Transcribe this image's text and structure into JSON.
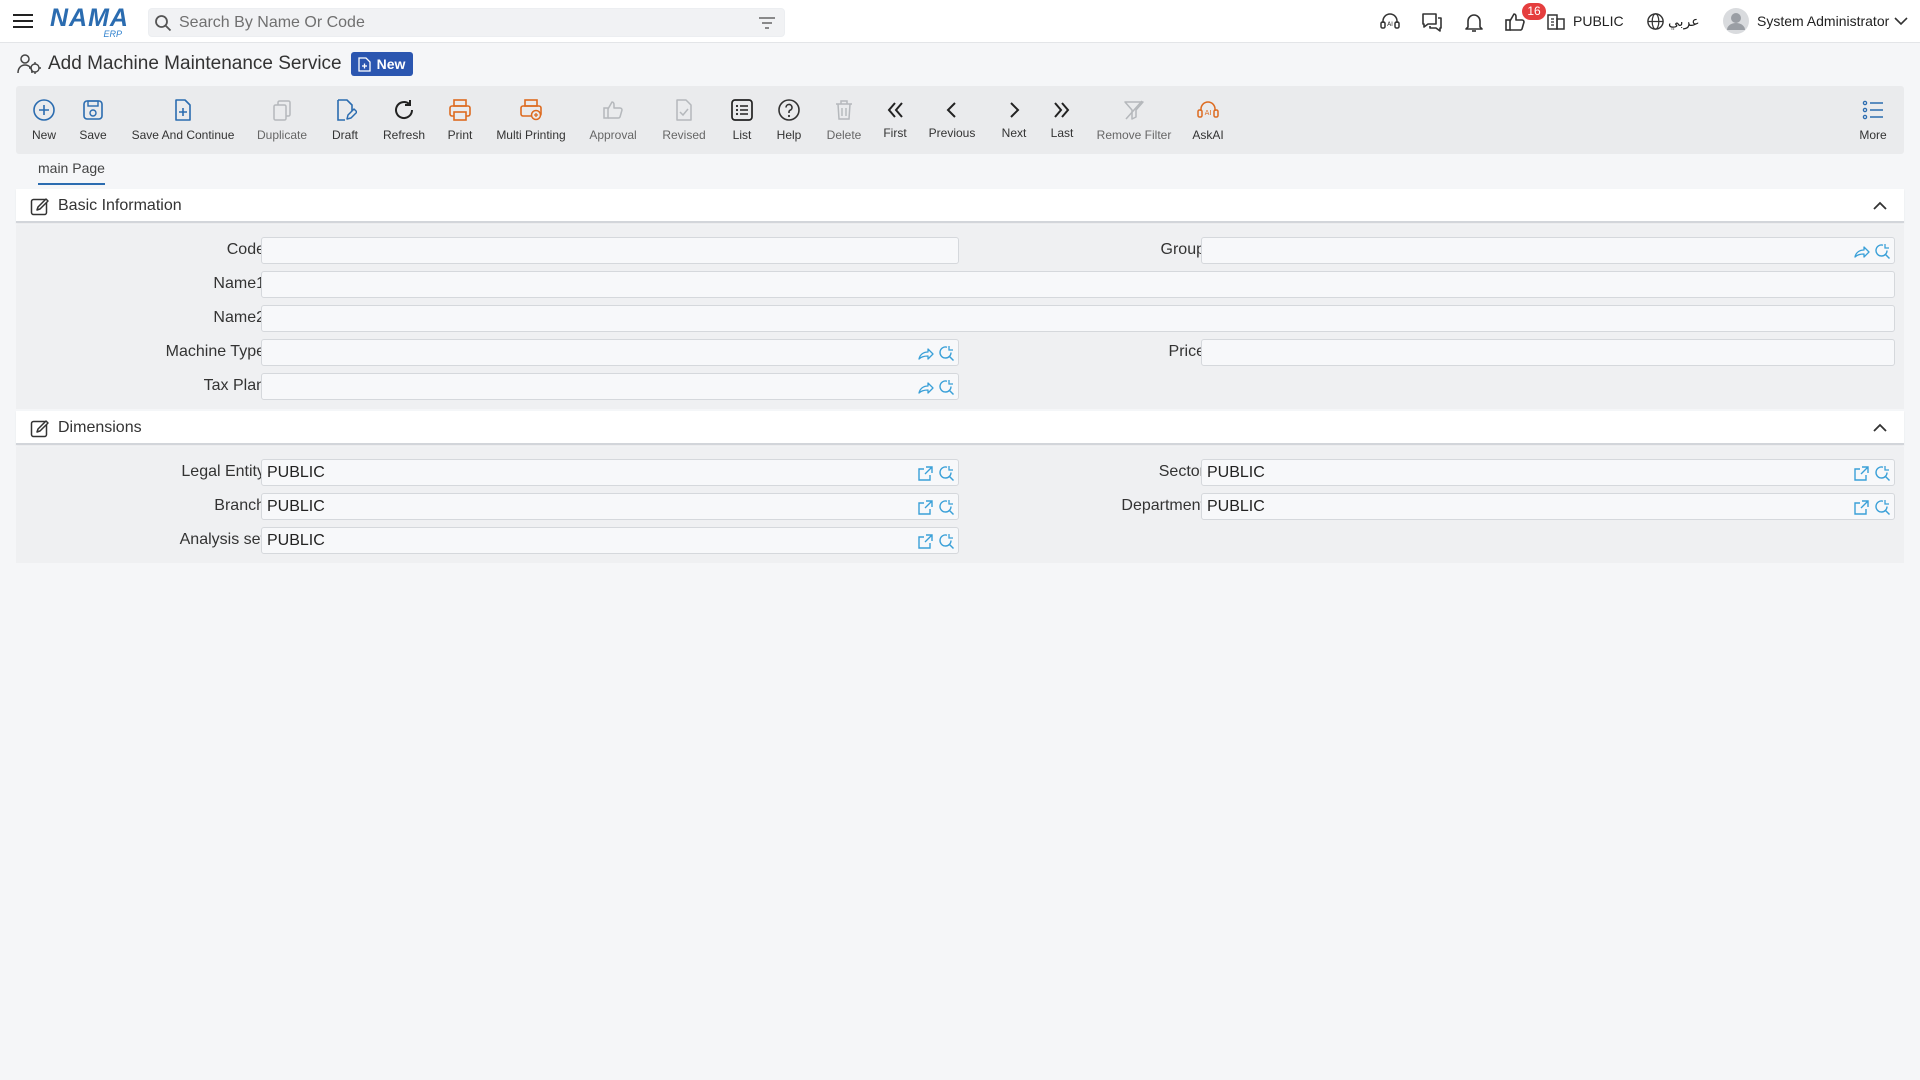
{
  "header": {
    "logo_text": "NAMA",
    "logo_sub": "ERP",
    "search_placeholder": "Search By Name Or Code",
    "notification_count": "16",
    "entity": "PUBLIC",
    "language": "عربي",
    "user": "System Administrator"
  },
  "page": {
    "title": "Add Machine Maintenance Service",
    "status_badge": "New"
  },
  "toolbar": {
    "new": "New",
    "save": "Save",
    "save_continue": "Save And Continue",
    "duplicate": "Duplicate",
    "draft": "Draft",
    "refresh": "Refresh",
    "print": "Print",
    "multi_printing": "Multi Printing",
    "approval": "Approval",
    "revised": "Revised",
    "list": "List",
    "help": "Help",
    "delete": "Delete",
    "first": "First",
    "previous": "Previous",
    "next": "Next",
    "last": "Last",
    "remove_filter": "Remove Filter",
    "askai": "AskAI",
    "more": "More"
  },
  "tabs": {
    "main": "main Page"
  },
  "basic": {
    "title": "Basic Information",
    "code_label": "Code",
    "code_value": "",
    "group_label": "Group",
    "group_value": "",
    "name1_label": "Name1",
    "name1_value": "",
    "name2_label": "Name2",
    "name2_value": "",
    "machine_type_label": "Machine Type",
    "machine_type_value": "",
    "price_label": "Price",
    "price_value": "",
    "tax_plan_label": "Tax Plan",
    "tax_plan_value": ""
  },
  "dimensions": {
    "title": "Dimensions",
    "legal_entity_label": "Legal Entity",
    "legal_entity_value": "PUBLIC",
    "sector_label": "Sector",
    "sector_value": "PUBLIC",
    "branch_label": "Branch",
    "branch_value": "PUBLIC",
    "department_label": "Department",
    "department_value": "PUBLIC",
    "analysis_set_label": "Analysis set",
    "analysis_set_value": "PUBLIC"
  },
  "colors": {
    "brand_blue": "#2b6cb0",
    "accent_orange": "#dd6b20",
    "badge_red": "#e53e3e",
    "link_icon_blue": "#3aa0d8"
  }
}
